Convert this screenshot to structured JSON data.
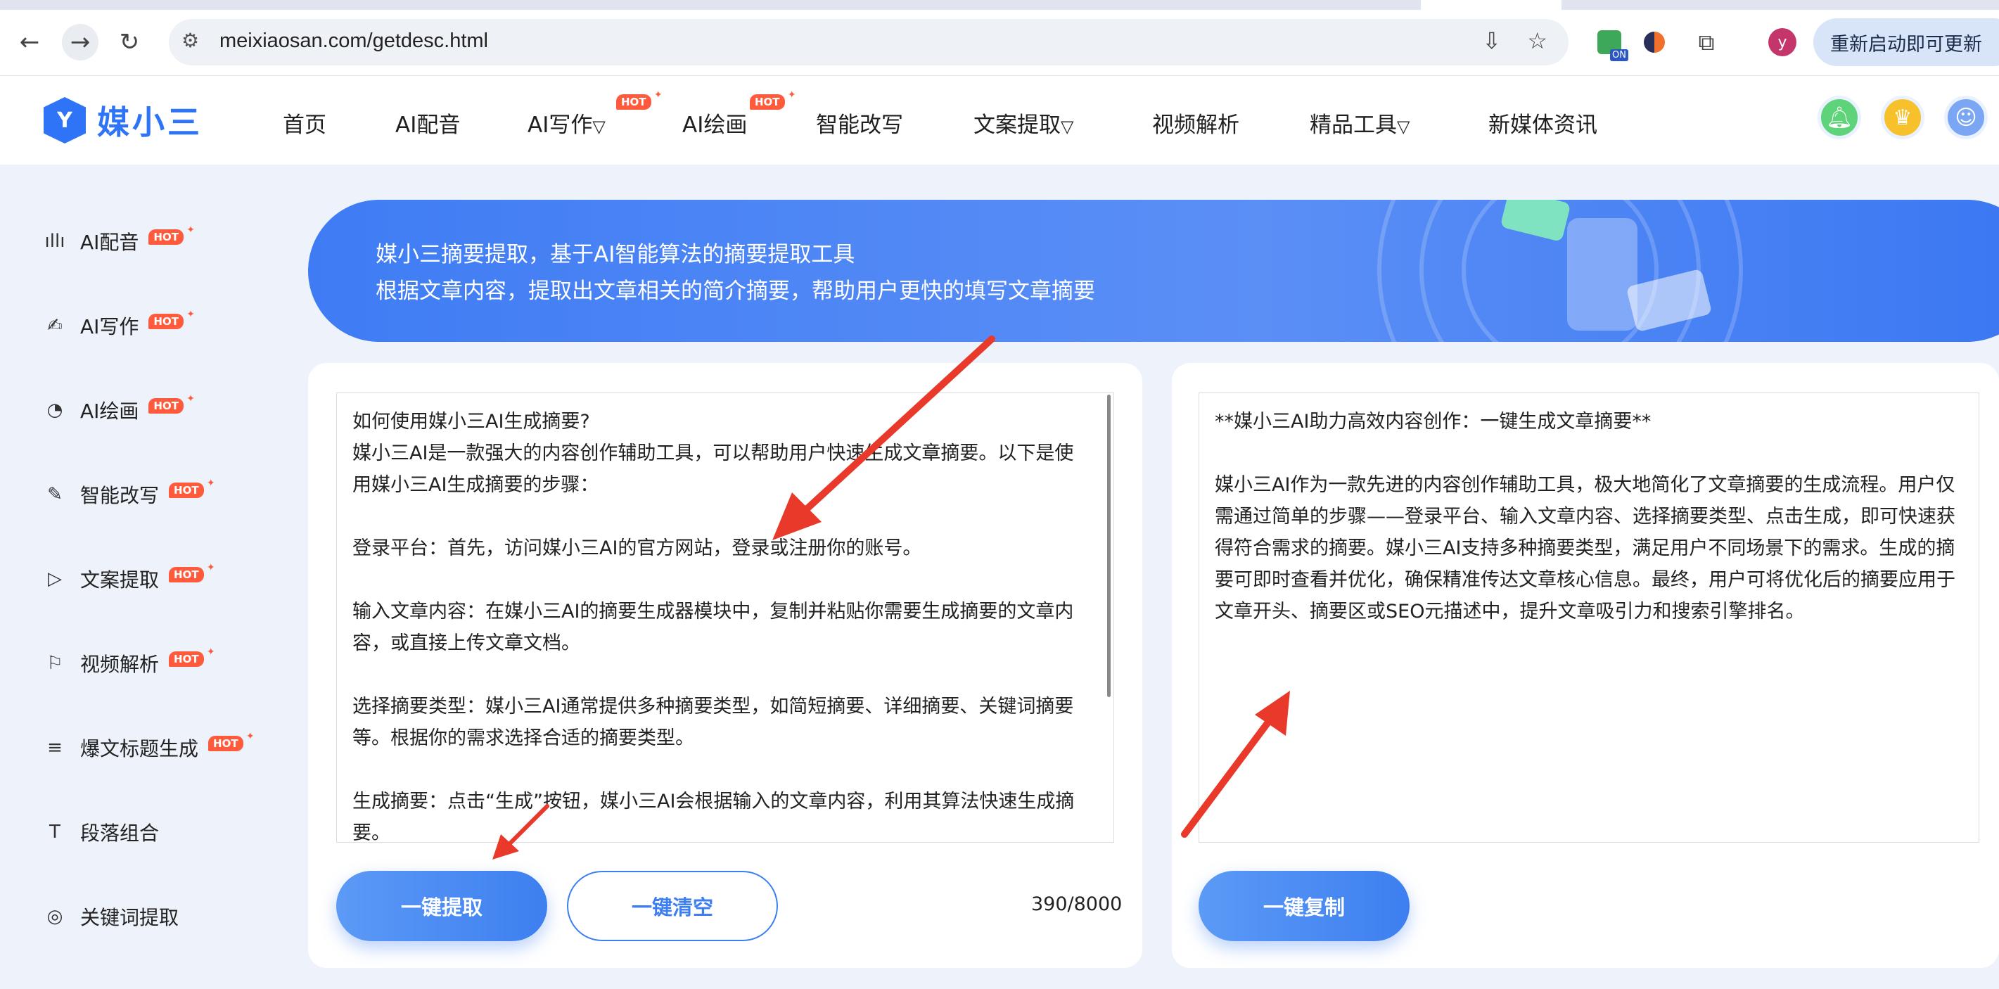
{
  "browser": {
    "url": "meixiaosan.com/getdesc.html",
    "update_button": "重新启动即可更新",
    "profile_initial": "y",
    "extension_badge": "ON"
  },
  "site": {
    "logo_text": "媒小三",
    "nav": [
      {
        "label": "首页"
      },
      {
        "label": "AI配音"
      },
      {
        "label": "AI写作",
        "caret": "▽",
        "hot": "HOT"
      },
      {
        "label": "AI绘画",
        "hot": "HOT"
      },
      {
        "label": "智能改写"
      },
      {
        "label": "文案提取",
        "caret": "▽"
      },
      {
        "label": "视频解析"
      },
      {
        "label": "精品工具",
        "caret": "▽"
      },
      {
        "label": "新媒体资讯"
      }
    ]
  },
  "sidebar": {
    "items": [
      {
        "label": "AI配音",
        "icon": "waveform-icon",
        "hot": "HOT"
      },
      {
        "label": "AI写作",
        "icon": "ai-write-icon",
        "hot": "HOT"
      },
      {
        "label": "AI绘画",
        "icon": "palette-icon",
        "hot": "HOT"
      },
      {
        "label": "智能改写",
        "icon": "edit-icon",
        "hot": "HOT"
      },
      {
        "label": "文案提取",
        "icon": "video-text-icon",
        "hot": "HOT"
      },
      {
        "label": "视频解析",
        "icon": "video-parse-icon",
        "hot": "HOT"
      },
      {
        "label": "爆文标题生成",
        "icon": "title-icon",
        "hot": "HOT"
      },
      {
        "label": "段落组合",
        "icon": "paragraph-icon"
      },
      {
        "label": "关键词提取",
        "icon": "keyword-icon"
      }
    ]
  },
  "banner": {
    "line1": "媒小三摘要提取，基于AI智能算法的摘要提取工具",
    "line2": "根据文章内容，提取出文章相关的简介摘要，帮助用户更快的填写文章摘要"
  },
  "input_panel": {
    "paragraphs": [
      "如何使用媒小三AI生成摘要?",
      "媒小三AI是一款强大的内容创作辅助工具，可以帮助用户快速生成文章摘要。以下是使用媒小三AI生成摘要的步骤：",
      "",
      "登录平台：首先，访问媒小三AI的官方网站，登录或注册你的账号。",
      "",
      "输入文章内容：在媒小三AI的摘要生成器模块中，复制并粘贴你需要生成摘要的文章内容，或直接上传文章文档。",
      "",
      "选择摘要类型：媒小三AI通常提供多种摘要类型，如简短摘要、详细摘要、关键词摘要等。根据你的需求选择合适的摘要类型。",
      "",
      "生成摘要：点击“生成”按钮，媒小三AI会根据输入的文章内容，利用其算法快速生成摘要。"
    ],
    "extract_button": "一键提取",
    "clear_button": "一键清空",
    "char_count": "390/8000"
  },
  "output_panel": {
    "paragraphs": [
      "**媒小三AI助力高效内容创作：一键生成文章摘要**",
      "",
      "媒小三AI作为一款先进的内容创作辅助工具，极大地简化了文章摘要的生成流程。用户仅需通过简单的步骤——登录平台、输入文章内容、选择摘要类型、点击生成，即可快速获得符合需求的摘要。媒小三AI支持多种摘要类型，满足用户不同场景下的需求。生成的摘要可即时查看并优化，确保精准传达文章核心信息。最终，用户可将优化后的摘要应用于文章开头、摘要区或SEO元描述中，提升文章吸引力和搜索引擎排名。"
    ],
    "copy_button": "一键复制"
  },
  "colors": {
    "accent": "#3d7ff0",
    "hot": "#ff5a3c",
    "arrow": "#e8392b"
  }
}
